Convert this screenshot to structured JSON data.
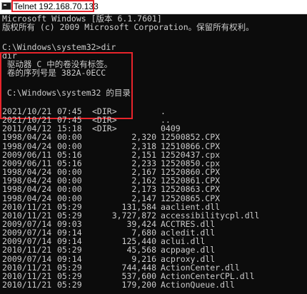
{
  "window": {
    "title": "Telnet 192.168.70.133"
  },
  "console": {
    "header_lines": [
      "Microsoft Windows [版本 6.1.7601]",
      "版权所有 (c) 2009 Microsoft Corporation。保留所有权利。"
    ],
    "command_lines": [
      "C:\\Windows\\system32>dir",
      "dir",
      " 驱动器 C 中的卷没有标签。",
      " 卷的序列号是 382A-0ECC",
      " C:\\Windows\\system32 的目录"
    ],
    "listing": [
      {
        "date": "2021/10/21",
        "time": "07:45",
        "dir": "<DIR>",
        "size": "",
        "name": "."
      },
      {
        "date": "2021/10/21",
        "time": "07:45",
        "dir": "<DIR>",
        "size": "",
        "name": ".."
      },
      {
        "date": "2011/04/12",
        "time": "15:18",
        "dir": "<DIR>",
        "size": "",
        "name": "0409"
      },
      {
        "date": "1998/04/24",
        "time": "00:00",
        "dir": "",
        "size": "2,320",
        "name": "12500852.CPX"
      },
      {
        "date": "1998/04/24",
        "time": "00:00",
        "dir": "",
        "size": "2,318",
        "name": "12510866.CPX"
      },
      {
        "date": "2009/06/11",
        "time": "05:16",
        "dir": "",
        "size": "2,151",
        "name": "12520437.cpx"
      },
      {
        "date": "2009/06/11",
        "time": "05:16",
        "dir": "",
        "size": "2,233",
        "name": "12520850.cpx"
      },
      {
        "date": "1998/04/24",
        "time": "00:00",
        "dir": "",
        "size": "2,167",
        "name": "12520860.CPX"
      },
      {
        "date": "1998/04/24",
        "time": "00:00",
        "dir": "",
        "size": "2,162",
        "name": "12520861.CPX"
      },
      {
        "date": "1998/04/24",
        "time": "00:00",
        "dir": "",
        "size": "2,173",
        "name": "12520863.CPX"
      },
      {
        "date": "1998/04/24",
        "time": "00:00",
        "dir": "",
        "size": "2,147",
        "name": "12520865.CPX"
      },
      {
        "date": "2010/11/21",
        "time": "05:29",
        "dir": "",
        "size": "131,584",
        "name": "aaclient.dll"
      },
      {
        "date": "2010/11/21",
        "time": "05:29",
        "dir": "",
        "size": "3,727,872",
        "name": "accessibilitycpl.dll"
      },
      {
        "date": "2009/07/14",
        "time": "09:03",
        "dir": "",
        "size": "39,424",
        "name": "ACCTRES.dll"
      },
      {
        "date": "2009/07/14",
        "time": "09:14",
        "dir": "",
        "size": "7,680",
        "name": "acledit.dll"
      },
      {
        "date": "2009/07/14",
        "time": "09:14",
        "dir": "",
        "size": "125,440",
        "name": "aclui.dll"
      },
      {
        "date": "2010/11/21",
        "time": "05:29",
        "dir": "",
        "size": "45,568",
        "name": "acppage.dll"
      },
      {
        "date": "2009/07/14",
        "time": "09:14",
        "dir": "",
        "size": "9,216",
        "name": "acproxy.dll"
      },
      {
        "date": "2010/11/21",
        "time": "05:29",
        "dir": "",
        "size": "744,448",
        "name": "ActionCenter.dll"
      },
      {
        "date": "2010/11/21",
        "time": "05:29",
        "dir": "",
        "size": "537,600",
        "name": "ActionCenterCPL.dll"
      },
      {
        "date": "2010/11/21",
        "time": "05:29",
        "dir": "",
        "size": "179,200",
        "name": "ActionQueue.dll"
      }
    ]
  },
  "colors": {
    "console_bg": "#0c0c0c",
    "console_text": "#cccccc",
    "highlight": "#e8242b"
  }
}
